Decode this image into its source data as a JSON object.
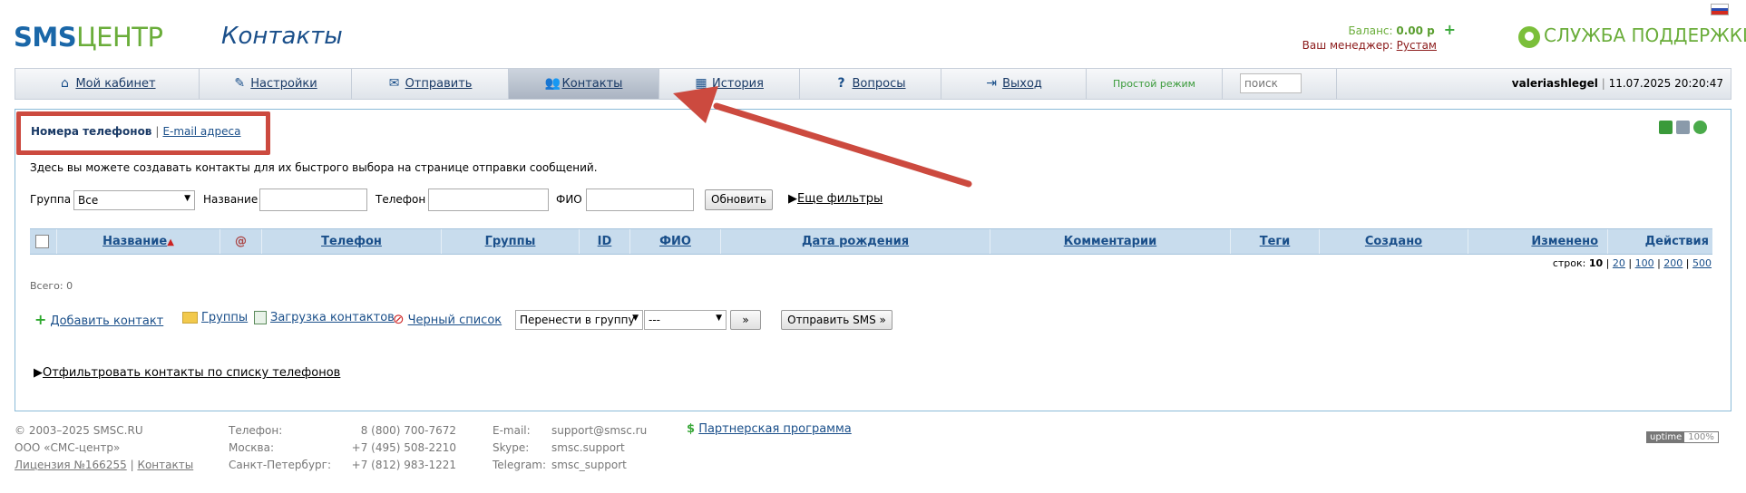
{
  "header": {
    "logo_sms": "SMS",
    "logo_center": "ЦЕНТР",
    "page_title": "Контакты",
    "balance_label": "Баланс:",
    "balance_value": "0.00 р",
    "manager_label": "Ваш менеджер:",
    "manager_name": "Рустам",
    "support_label": "СЛУЖБА ПОДДЕРЖКИ"
  },
  "nav": {
    "items": [
      {
        "label": "Мой кабинет",
        "icon": "home-icon"
      },
      {
        "label": "Настройки",
        "icon": "wrench-icon"
      },
      {
        "label": "Отправить",
        "icon": "envelope-icon"
      },
      {
        "label": "Контакты",
        "icon": "users-icon"
      },
      {
        "label": "История",
        "icon": "calendar-icon"
      },
      {
        "label": "Вопросы",
        "icon": "question-icon"
      },
      {
        "label": "Выход",
        "icon": "exit-icon"
      }
    ],
    "simple_mode": "Простой режим",
    "search_placeholder": "поиск",
    "username": "valeriashlegel",
    "datetime": "11.07.2025 20:20:47"
  },
  "tabs": {
    "phones": "Номера телефонов",
    "separator": "|",
    "emails": "E-mail адреса"
  },
  "description": "Здесь вы можете создавать контакты для их быстрого выбора на странице отправки сообщений.",
  "filters": {
    "group_label": "Группа",
    "group_value": "Все",
    "name_label": "Название",
    "phone_label": "Телефон",
    "fio_label": "ФИО",
    "refresh_button": "Обновить",
    "more_filters": "Еще фильтры"
  },
  "table": {
    "columns": [
      "Название",
      "@",
      "Телефон",
      "Группы",
      "ID",
      "ФИО",
      "Дата рождения",
      "Комментарии",
      "Теги",
      "Создано",
      "Изменено",
      "Действия"
    ],
    "rows_label": "строк:",
    "rows_current": "10",
    "rows_options": [
      "20",
      "100",
      "200",
      "500"
    ],
    "total": "Всего: 0"
  },
  "actions": {
    "add_contact": "Добавить контакт",
    "groups": "Группы",
    "upload": "Загрузка контактов",
    "blacklist": "Черный список",
    "move_to_group": "Перенести в группу",
    "group_select": "---",
    "go_button": "»",
    "send_sms": "Отправить SMS »",
    "filter_by_phones": "Отфильтровать контакты по списку телефонов"
  },
  "footer": {
    "copyright": "© 2003–2025 SMSC.RU",
    "company": "ООО «СМС-центр»",
    "license": "Лицензия №166255",
    "license_sep": "|",
    "contacts": "Контакты",
    "phone_label": "Телефон:",
    "phone_value": "8 (800) 700-7672",
    "moscow_label": "Москва:",
    "moscow_value": "+7 (495) 508-2210",
    "spb_label": "Санкт-Петербург:",
    "spb_value": "+7 (812) 983-1221",
    "email_label": "E-mail:",
    "email_value": "support@smsc.ru",
    "skype_label": "Skype:",
    "skype_value": "smsc.support",
    "telegram_label": "Telegram:",
    "telegram_value": "smsc_support",
    "partner": "Партнерская программа",
    "uptime_label": "uptime",
    "uptime_value": "100%"
  },
  "colors": {
    "brand_blue": "#1a67a8",
    "brand_green": "#6aad3a",
    "annotation_red": "#cc4a3f",
    "table_header_bg": "#c8dced"
  }
}
